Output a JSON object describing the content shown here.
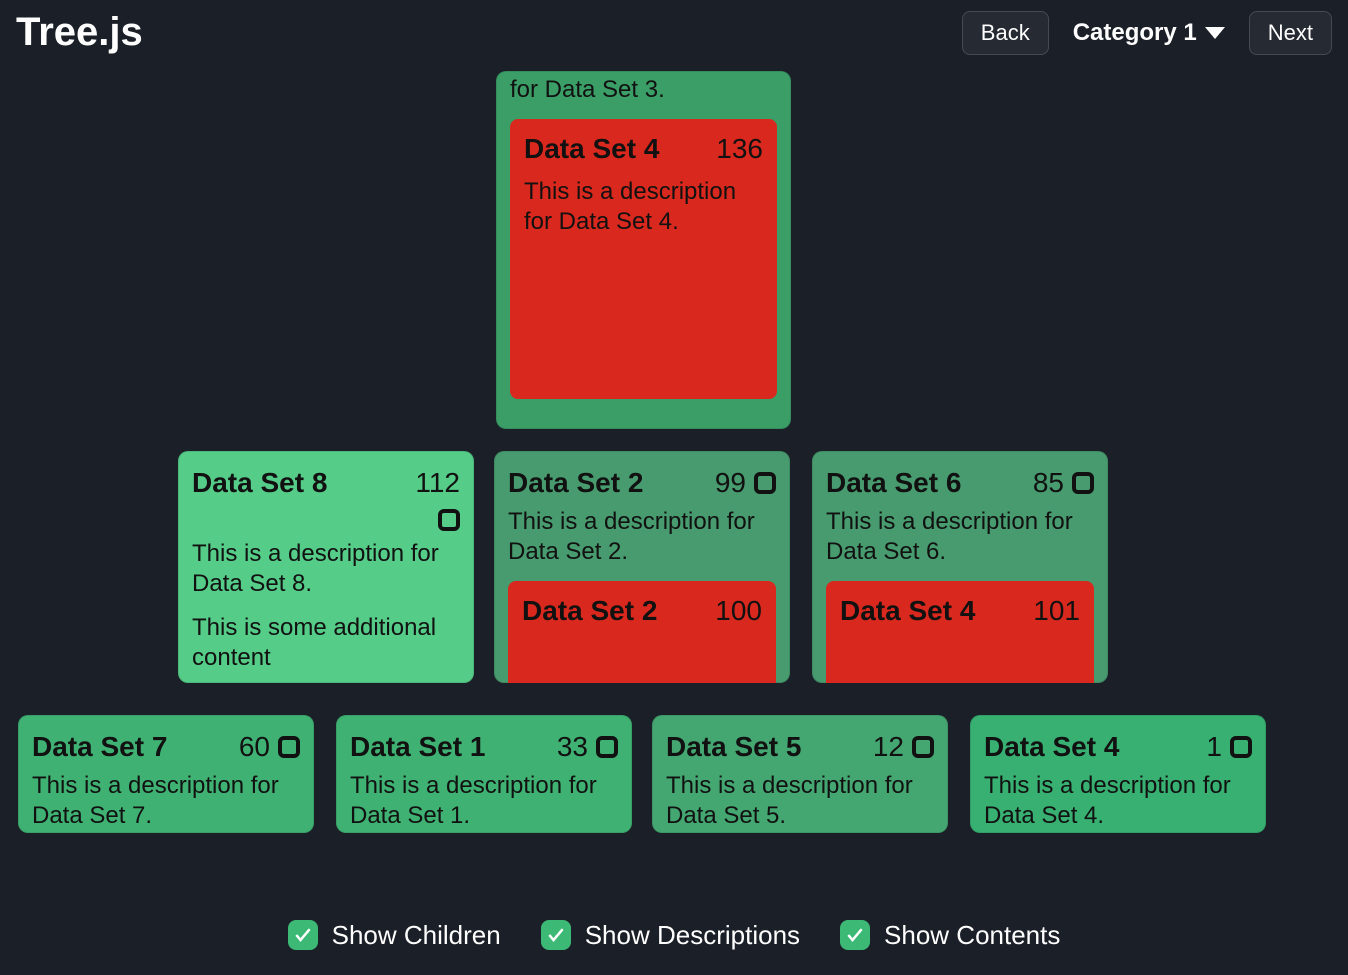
{
  "header": {
    "title": "Tree.js",
    "back": "Back",
    "category": "Category 1",
    "next": "Next"
  },
  "root": {
    "desc_partial": "for Data Set 3.",
    "child": {
      "title": "Data Set 4",
      "value": "136",
      "desc": "This is a description for Data Set 4."
    }
  },
  "row2": {
    "ds8": {
      "title": "Data Set 8",
      "value": "112",
      "desc": "This is a description for Data Set 8.",
      "content": "This is some additional content"
    },
    "ds2": {
      "title": "Data Set 2",
      "value": "99",
      "desc": "This is a description for Data Set 2.",
      "child": {
        "title": "Data Set 2",
        "value": "100"
      }
    },
    "ds6": {
      "title": "Data Set 6",
      "value": "85",
      "desc": "This is a description for Data Set 6.",
      "child": {
        "title": "Data Set 4",
        "value": "101"
      }
    }
  },
  "row3": {
    "ds7": {
      "title": "Data Set 7",
      "value": "60",
      "desc": "This is a description for Data Set 7."
    },
    "ds1": {
      "title": "Data Set 1",
      "value": "33",
      "desc": "This is a description for Data Set 1."
    },
    "ds5": {
      "title": "Data Set 5",
      "value": "12",
      "desc": "This is a description for Data Set 5."
    },
    "ds4": {
      "title": "Data Set 4",
      "value": "1",
      "desc": "This is a description for Data Set 4."
    }
  },
  "footer": {
    "children": "Show Children",
    "descriptions": "Show Descriptions",
    "contents": "Show Contents"
  }
}
